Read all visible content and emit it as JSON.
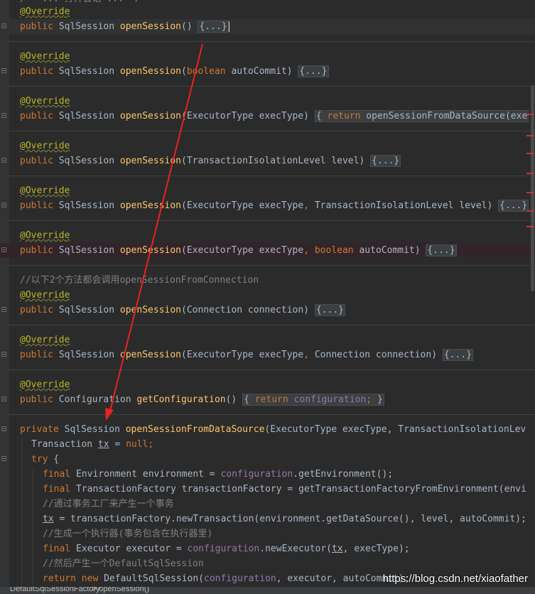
{
  "editor": {
    "override": "@Override",
    "folded_body": "{...}",
    "methods": [
      {
        "mod": "public",
        "type": "SqlSession",
        "name": "openSession",
        "params_html": "()"
      },
      {
        "mod": "public",
        "type": "SqlSession",
        "name": "openSession",
        "p1kw": "boolean",
        "p1": " autoCommit"
      },
      {
        "mod": "public",
        "type": "SqlSession",
        "name": "openSession",
        "params": "(ExecutorType execType)",
        "inline_kw": "return",
        "inline": " openSessionFromDataSource(exe"
      },
      {
        "mod": "public",
        "type": "SqlSession",
        "name": "openSession",
        "params": "(TransactionIsolationLevel level)"
      },
      {
        "mod": "public",
        "type": "SqlSession",
        "name": "openSession",
        "params_a": "(ExecutorType execType",
        "comma": ",",
        "params_b": " TransactionIsolationLevel level)"
      },
      {
        "mod": "public",
        "type": "SqlSession",
        "name": "openSession",
        "params_a": "(ExecutorType execType",
        "comma": ",",
        "p_kw": "boolean",
        "params_b": " autoCommit)"
      },
      {
        "mod": "public",
        "type": "SqlSession",
        "name": "openSession",
        "params": "(Connection connection)"
      },
      {
        "mod": "public",
        "type": "SqlSession",
        "name": "openSession",
        "params_a": "(ExecutorType execType",
        "comma": ",",
        "params_b": " Connection connection)"
      },
      {
        "mod": "public",
        "type": "Configuration",
        "name": "getConfiguration",
        "params": "()",
        "inline_kw": "return",
        "inline_fld": "configuration",
        "semi": ";"
      }
    ],
    "comment_connection": "//以下2个方法都会调用openSessionFromConnection",
    "private_method": {
      "mod": "private",
      "type": "SqlSession",
      "name": "openSessionFromDataSource",
      "params": "(ExecutorType execType, TransactionIsolationLev"
    },
    "body": {
      "l1_type": "Transaction ",
      "l1_var": "tx",
      "l1_eq": " = ",
      "l1_null": "null",
      "l1_semi": ";",
      "l2_try": "try",
      "l2_brace": " {",
      "l3_final": "final",
      "l3_rest": " Environment environment = ",
      "l3_fld": "configuration",
      "l3_call": ".getEnvironment();",
      "l4_final": "final",
      "l4_rest": " TransactionFactory transactionFactory = getTransactionFactoryFromEnvironment(envi",
      "c1": "//通过事务工厂来产生一个事务",
      "l5_var": "tx",
      "l5_rest": " = transactionFactory.newTransaction(environment.getDataSource(), level, autoCommit);",
      "c2": "//生成一个执行器(事务包含在执行器里)",
      "l6_final": "final",
      "l6_rest": " Executor executor = ",
      "l6_fld": "configuration",
      "l6_call": ".newExecutor(",
      "l6_tx": "tx",
      "l6_end": ", execType);",
      "c3": "//然后产生一个DefaultSqlSession",
      "l7_kw": "return new",
      "l7_rest": " DefaultSqlSession(",
      "l7_fld": "configuration",
      "l7_end": ", executor, autoCommit);"
    }
  },
  "top_partial": "/** ... 打开会话 ... */",
  "breadcrumb": {
    "class": "DefaultSqlSessionFactory",
    "sep": " > ",
    "method": "openSession()"
  },
  "watermark": "https://blog.csdn.net/xiaofather",
  "colors": {
    "keyword": "#cc7832",
    "annotation": "#bbb529",
    "method": "#ffc66d",
    "field": "#9876aa",
    "comment": "#808080",
    "arrow": "#e8231f"
  }
}
